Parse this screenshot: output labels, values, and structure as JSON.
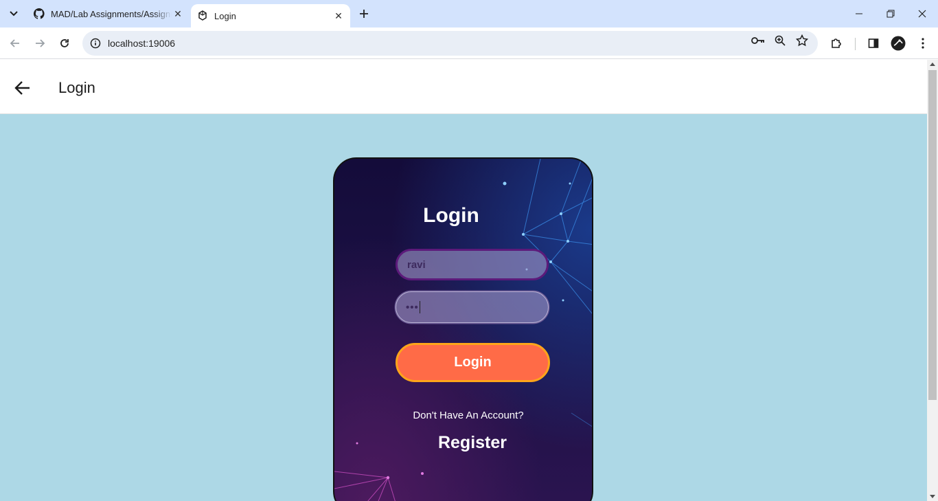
{
  "browser": {
    "tabs": [
      {
        "title": "MAD/Lab Assignments/Assignm",
        "favicon": "github-icon",
        "active": false
      },
      {
        "title": "Login",
        "favicon": "expo-icon",
        "active": true
      }
    ],
    "address": "localhost:19006"
  },
  "app": {
    "header_title": "Login",
    "card": {
      "title": "Login",
      "username_value": "ravi",
      "password_value": "•••",
      "login_button": "Login",
      "question": "Don't Have An Account?",
      "register_link": "Register"
    }
  },
  "colors": {
    "page_bg": "#add8e6",
    "button_fill": "#ff6b47",
    "button_border": "#ffa51a",
    "tabstrip": "#d3e3fd"
  }
}
